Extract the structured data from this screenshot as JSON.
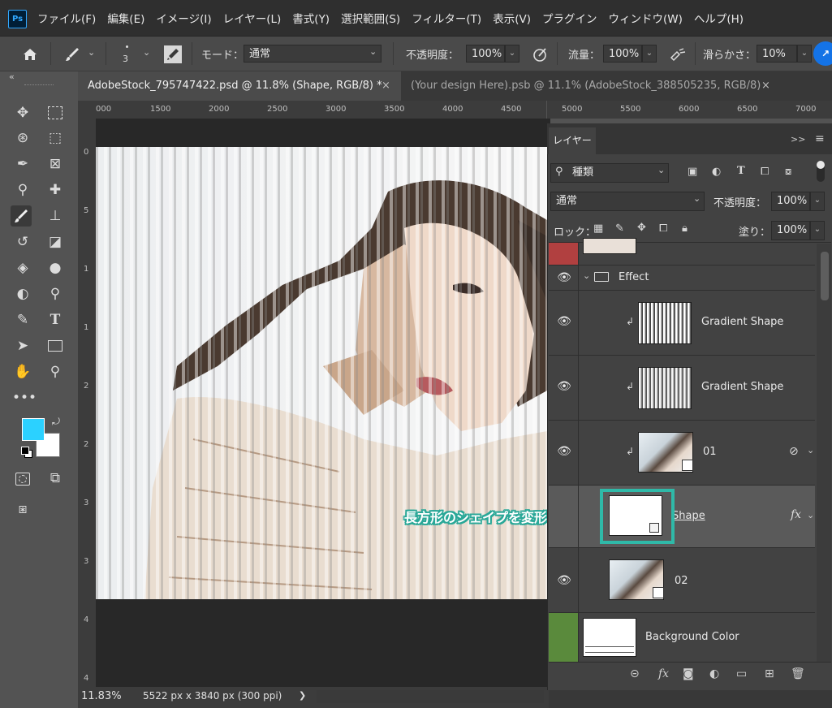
{
  "app": {
    "logo": "Ps"
  },
  "menu": [
    "ファイル(F)",
    "編集(E)",
    "イメージ(I)",
    "レイヤー(L)",
    "書式(Y)",
    "選択範囲(S)",
    "フィルター(T)",
    "表示(V)",
    "プラグイン",
    "ウィンドウ(W)",
    "ヘルプ(H)"
  ],
  "options": {
    "brush_size": "3",
    "mode_label": "モード：",
    "mode_value": "通常",
    "opacity_label": "不透明度：",
    "opacity_value": "100%",
    "flow_label": "流量：",
    "flow_value": "100%",
    "smoothing_label": "滑らかさ：",
    "smoothing_value": "10%",
    "collapse": "«"
  },
  "tabs": [
    {
      "label": "AdobeStock_795747422.psd @ 11.8% (Shape, RGB/8) *",
      "close": "×"
    },
    {
      "label": "(Your design Here).psb @ 11.1% (AdobeStock_388505235, RGB/8)",
      "close": "×"
    }
  ],
  "ruler_top": [
    "000",
    "1500",
    "2000",
    "2500",
    "3000",
    "3500",
    "4000",
    "4500",
    "5000",
    "5500",
    "6000",
    "6500",
    "7000"
  ],
  "ruler_left": [
    "0",
    "5",
    "1",
    "1",
    "2",
    "2",
    "3",
    "3",
    "4",
    "4"
  ],
  "status": {
    "zoom": "11.83%",
    "doc_size": "5522 px x 3840 px (300 ppi)",
    "arrow": "❯"
  },
  "layers_panel": {
    "tab": "レイヤー",
    "filter_label": "種類",
    "blend_mode": "通常",
    "opacity_label": "不透明度：",
    "opacity_value": "100%",
    "lock_label": "ロック：",
    "fill_label": "塗り：",
    "fill_value": "100%",
    "expand": ">>",
    "menu": "≡"
  },
  "layers": [
    {
      "name": "Effect"
    },
    {
      "name": "Gradient Shape"
    },
    {
      "name": "Gradient Shape"
    },
    {
      "name": "01"
    },
    {
      "name": "Shape",
      "fx": "fx"
    },
    {
      "name": "02"
    },
    {
      "name": "Background Color"
    }
  ],
  "annotation": {
    "text": "長方形のシェイプを変形"
  },
  "colors": {
    "foreground": "#2bd1ff",
    "background": "#ffffff",
    "highlight": "#2fb9a8",
    "red_swatch": "#b14040",
    "green_swatch": "#5a8a3c"
  },
  "icons": [
    "home-icon",
    "brush-icon",
    "move-icon",
    "marquee-icon",
    "lasso-icon",
    "eyedropper-icon",
    "eye-icon",
    "folder-icon",
    "lock-icon",
    "trash-icon"
  ]
}
